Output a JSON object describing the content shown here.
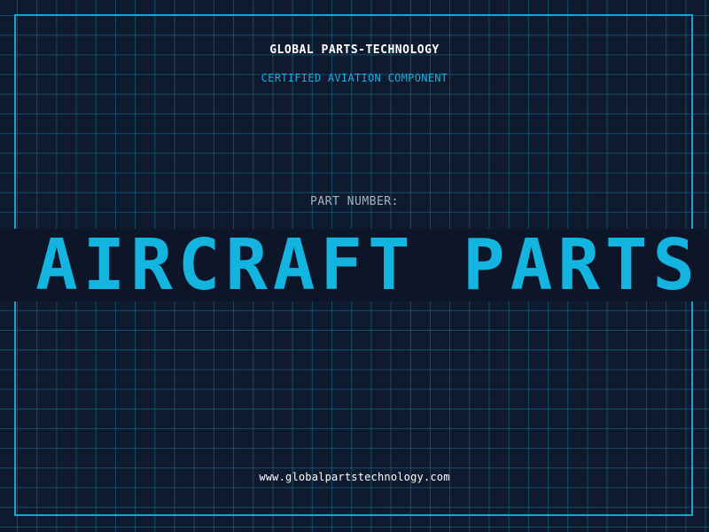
{
  "header": {
    "company_name": "GLOBAL PARTS-TECHNOLOGY",
    "tagline": "CERTIFIED AVIATION COMPONENT"
  },
  "part": {
    "label": "PART NUMBER:",
    "banner_text": "E AIRCRAFT PARTS B"
  },
  "footer": {
    "website": "www.globalpartstechnology.com"
  },
  "colors": {
    "background": "#0f1a2e",
    "grid": "#168caf",
    "accent": "#13b5e0",
    "frame": "#18a4cf",
    "label": "#a8b3c2"
  }
}
